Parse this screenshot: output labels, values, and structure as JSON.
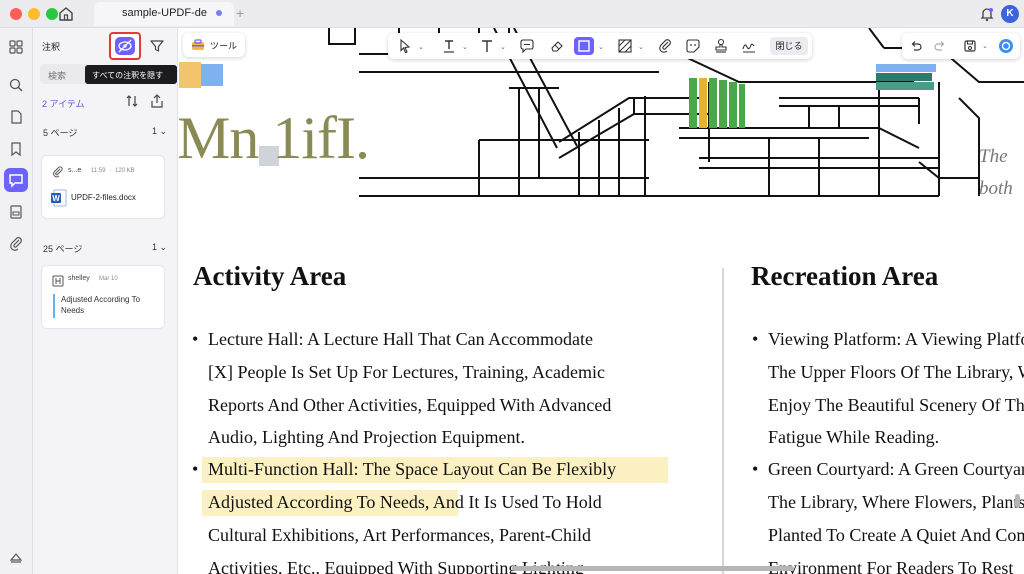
{
  "titlebar": {
    "tab_title": "sample-UPDF-de",
    "avatar_letter": "K"
  },
  "panel": {
    "title": "注釈",
    "tooltip": "すべての注釈を隠す",
    "search_placeholder": "検索",
    "count": "2 アイテム",
    "groups": [
      {
        "page": "5 ページ",
        "count": "1",
        "card": {
          "name": "s...e",
          "time": "11:59",
          "size": "120 KB",
          "file": "UPDF-2-files.docx"
        }
      },
      {
        "page": "25 ページ",
        "count": "1",
        "card": {
          "author": "shelley",
          "date": "Mar 10",
          "text": "Adjusted According To Needs"
        }
      }
    ]
  },
  "toolbar": {
    "tool_label": "ツール",
    "close_label": "閉じる"
  },
  "document": {
    "logo_text": "Mn 1ifI.",
    "side_text": [
      "The",
      "both"
    ],
    "left": {
      "heading": "Activity Area",
      "lines": [
        "Lecture Hall: A Lecture Hall That Can Accommodate",
        "[X] People Is Set Up For Lectures, Training, Academic",
        "Reports And Other Activities, Equipped With Advanced",
        "Audio, Lighting And Projection Equipment.",
        "Multi-Function Hall: The Space Layout Can Be Flexibly",
        "Adjusted According To Needs, And It Is Used To Hold",
        "Cultural Exhibitions, Art Performances, Parent-Child",
        "Activities, Etc., Equipped With Supporting Lighting"
      ]
    },
    "right": {
      "heading": "Recreation Area",
      "lines": [
        "Viewing Platform: A Viewing Platform Is Set Up On",
        "The Upper Floors Of The Library, Where Readers Can",
        "Enjoy The Beautiful Scenery Of The Campus And Relieve",
        "Fatigue While Reading.",
        "Green Courtyard: A Green Courtyard Is Set Up Inside",
        "The Library, Where Flowers, Plants And Trees Are",
        "Planted To Create A Quiet And Comfortable Reading",
        "Environment For Readers To Rest"
      ]
    }
  },
  "colors": {
    "accent": "#6c63ff",
    "highlight": "#fbf0c2",
    "tooltip_bg": "#1c1c1e",
    "hide_button_outline": "#e53935"
  }
}
